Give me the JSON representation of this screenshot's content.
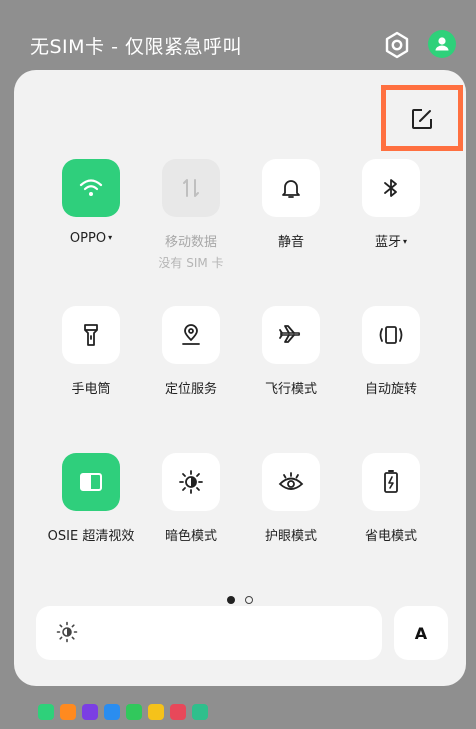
{
  "status": {
    "carrier_text": "无SIM卡 - 仅限紧急呼叫"
  },
  "tiles": [
    {
      "label": "OPPO",
      "caret": "▾",
      "sub": ""
    },
    {
      "label": "移动数据",
      "caret": "",
      "sub": "没有 SIM 卡"
    },
    {
      "label": "静音",
      "caret": "",
      "sub": ""
    },
    {
      "label": "蓝牙",
      "caret": "▾",
      "sub": ""
    },
    {
      "label": "手电筒",
      "caret": "",
      "sub": ""
    },
    {
      "label": "定位服务",
      "caret": "",
      "sub": ""
    },
    {
      "label": "飞行模式",
      "caret": "",
      "sub": ""
    },
    {
      "label": "自动旋转",
      "caret": "",
      "sub": ""
    },
    {
      "label": "OSIE 超清视效",
      "caret": "",
      "sub": ""
    },
    {
      "label": "暗色模式",
      "caret": "",
      "sub": ""
    },
    {
      "label": "护眼模式",
      "caret": "",
      "sub": ""
    },
    {
      "label": "省电模式",
      "caret": "",
      "sub": ""
    }
  ],
  "pager": {
    "current": 1,
    "total": 2
  },
  "brightness": {
    "auto_label": "A"
  },
  "colors": {
    "accent": "#2fcf7c",
    "highlight": "#ff7040"
  },
  "tray": [
    "notification-app-icon",
    "weibo-app-icon",
    "video-app-icon",
    "browser-app-icon",
    "iqiyi-app-icon",
    "58-app-icon",
    "game-app-icon",
    "security-app-icon"
  ]
}
